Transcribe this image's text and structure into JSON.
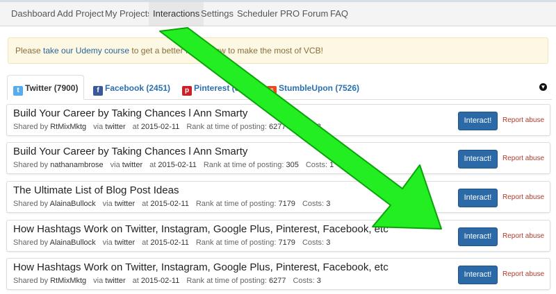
{
  "nav": {
    "items": [
      "Dashboard",
      "Add Project",
      "My Projects",
      "Interactions",
      "Settings",
      "Scheduler",
      "PRO Forum",
      "FAQ"
    ],
    "active_index": 3
  },
  "alert": {
    "prefix": "Please ",
    "link": "take our Udemy course",
    "suffix": " to get a better feel of how to make the most of VCB!"
  },
  "tabs": [
    {
      "label": "Twitter (7900)",
      "icon": "twitter-icon",
      "icon_color": "#55acee"
    },
    {
      "label": "Facebook (2451)",
      "icon": "facebook-icon",
      "icon_color": "#3b5998"
    },
    {
      "label": "Pinterest (3",
      "icon": "pinterest-icon",
      "icon_color": "#cb2027"
    },
    {
      "label": "StumbleUpon (7526)",
      "icon": "stumbleupon-icon",
      "icon_color": "#eb4924"
    }
  ],
  "labels": {
    "shared_by": "Shared by",
    "via": "via",
    "at": "at",
    "rank": "Rank at time of posting:",
    "costs": "Costs:",
    "interact": "Interact!",
    "report": "Report abuse"
  },
  "items": [
    {
      "title": "Build Your Career by Taking Chances l Ann Smarty",
      "user": "RtMixMktg",
      "network": "twitter",
      "date": "2015-02-11",
      "rank": "6277",
      "costs": "3"
    },
    {
      "title": "Build Your Career by Taking Chances l Ann Smarty",
      "user": "nathanambrose",
      "network": "twitter",
      "date": "2015-02-11",
      "rank": "305",
      "costs": "1"
    },
    {
      "title": "The Ultimate List of Blog Post Ideas",
      "user": "AlainaBullock",
      "network": "twitter",
      "date": "2015-02-11",
      "rank": "7179",
      "costs": "3"
    },
    {
      "title": "How Hashtags Work on Twitter, Instagram, Google Plus, Pinterest, Facebook, etc",
      "user": "AlainaBullock",
      "network": "twitter",
      "date": "2015-02-11",
      "rank": "7179",
      "costs": "3"
    },
    {
      "title": "How Hashtags Work on Twitter, Instagram, Google Plus, Pinterest, Facebook, etc",
      "user": "RtMixMktg",
      "network": "twitter",
      "date": "2015-02-11",
      "rank": "6277",
      "costs": "3"
    }
  ],
  "colors": {
    "arrow": "#22ee22",
    "button": "#2b6aa7",
    "alert_bg": "#fcf8e3"
  }
}
